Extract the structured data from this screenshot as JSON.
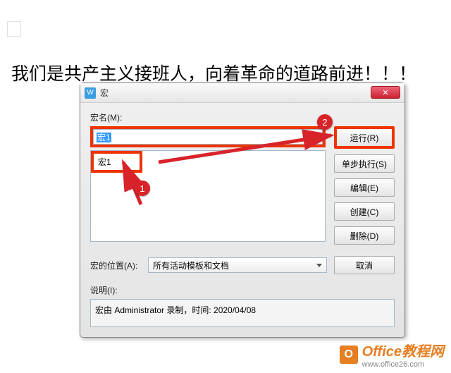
{
  "document": {
    "sentence": "我们是共产主义接班人，向着革命的道路前进！！！"
  },
  "dialog": {
    "title": "宏",
    "close_glyph": "✕",
    "macro_name_label": "宏名(M):",
    "macro_name_value": "宏1",
    "list_items": [
      "宏1"
    ],
    "buttons": {
      "run": "运行(R)",
      "step": "单步执行(S)",
      "edit": "编辑(E)",
      "create": "创建(C)",
      "delete": "删除(D)",
      "cancel": "取消"
    },
    "location_label": "宏的位置(A):",
    "location_value": "所有活动模板和文档",
    "description_label": "说明(I):",
    "description_value": "宏由 Administrator 录制，时间: 2020/04/08"
  },
  "annotations": {
    "badge1": "1",
    "badge2": "2"
  },
  "footer": {
    "icon_letter": "O",
    "brand": "Office教程网",
    "url": "www.office26.com"
  }
}
